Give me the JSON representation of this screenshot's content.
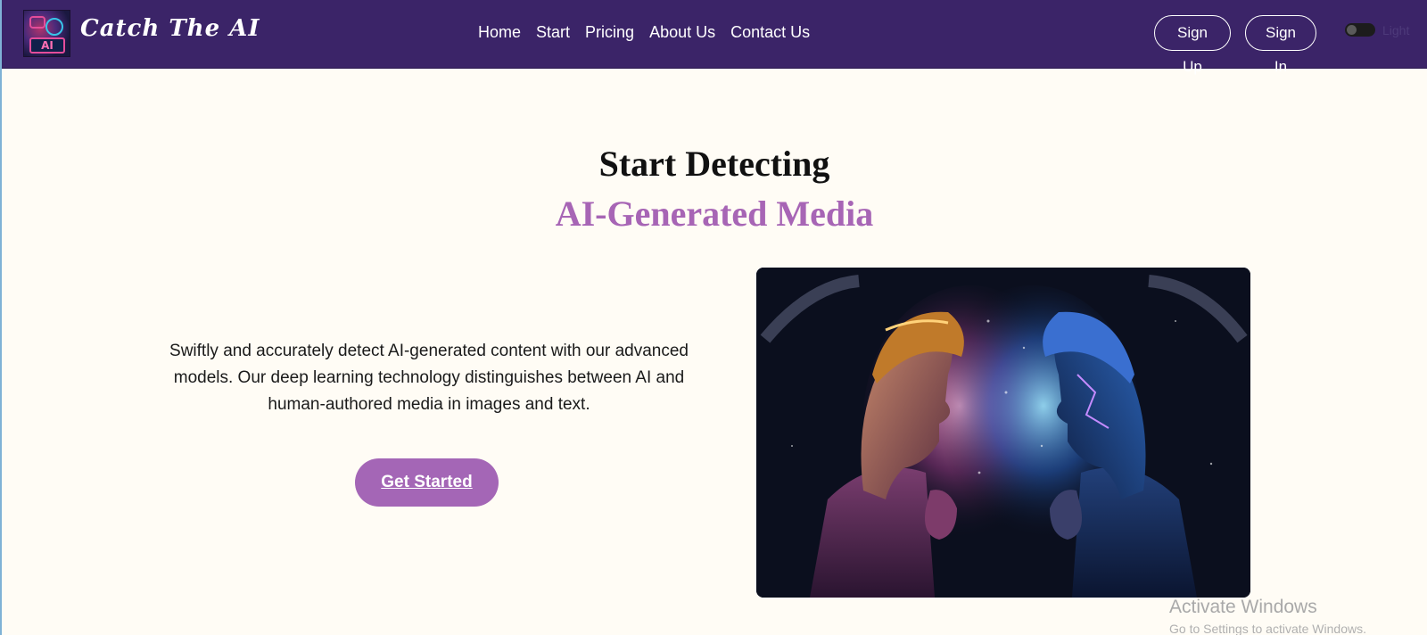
{
  "nav": {
    "brand": "Catch The AI",
    "logo_text": "AI",
    "links": [
      "Home",
      "Start",
      "Pricing",
      "About Us",
      "Contact Us"
    ],
    "signup": "Sign Up",
    "signin": "Sign In",
    "theme_toggle_label": "Light"
  },
  "hero": {
    "title_line1": "Start Detecting",
    "title_line2": "AI-Generated Media",
    "description": "Swiftly and accurately detect AI-generated content with our advanced models. Our deep learning technology distinguishes between AI and human-authored media in images and text.",
    "cta": "Get Started",
    "image_icon": "two-robot-faces-image"
  },
  "os_overlay": {
    "line1": "Activate Windows",
    "line2": "Go to Settings to activate Windows."
  },
  "colors": {
    "navbar": "#3b2468",
    "accent": "#a765b5",
    "page_background": "#fffcf5"
  }
}
